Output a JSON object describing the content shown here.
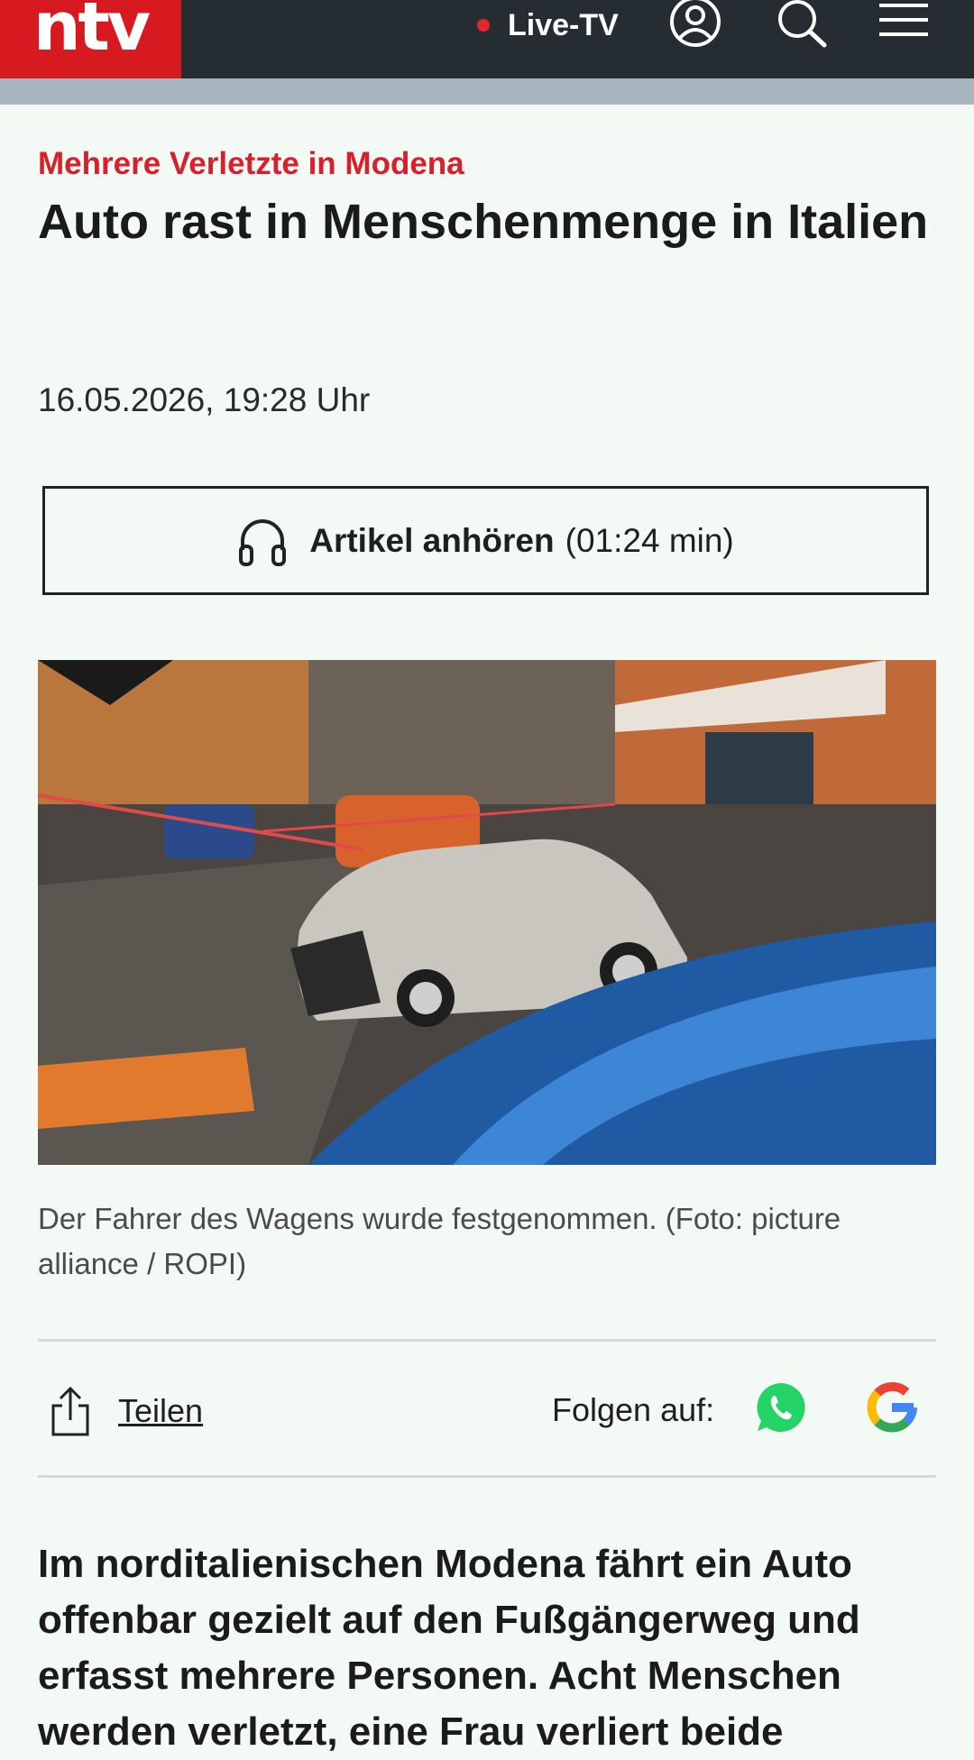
{
  "header": {
    "logo_text": "ntv",
    "live_label": "Live-TV",
    "icons": [
      "user-icon",
      "search-icon",
      "menu-icon"
    ],
    "colors": {
      "bar": "#252d33",
      "brand": "#d71920",
      "subbar": "#a6b5be"
    }
  },
  "article": {
    "kicker": "Mehrere Verletzte in Modena",
    "headline": "Auto rast in Menschenmenge in Italien",
    "date": "16.05.2026, 19:28 Uhr",
    "listen": {
      "label": "Artikel anhören",
      "duration": "(01:24 min)"
    },
    "image_caption": "Der Fahrer des Wagens wurde festgenommen. (Foto: picture alliance / ROPI)",
    "share_label": "Teilen",
    "follow_label": "Folgen auf:",
    "follow_icons": [
      "whatsapp-icon",
      "google-icon"
    ],
    "lead": "Im norditalienischen Modena fährt ein Auto offenbar gezielt auf den Fußgängerweg und erfasst mehrere Personen. Acht Menschen werden verletzt, eine Frau verliert beide"
  },
  "colors": {
    "accent": "#d7202a",
    "background": "#f3faf6"
  }
}
